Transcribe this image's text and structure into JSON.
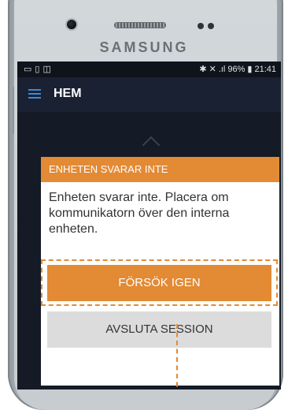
{
  "device": {
    "brand": "SAMSUNG"
  },
  "statusbar": {
    "battery": "96%",
    "time": "21:41",
    "signal": ".ıl",
    "left_icons": [
      "image-icon",
      "sim-icon",
      "cast-icon"
    ],
    "right_icons": [
      "bluetooth-icon",
      "mute-icon",
      "signal-icon",
      "battery-icon"
    ]
  },
  "appbar": {
    "title": "HEM"
  },
  "dialog": {
    "header": "ENHETEN SVARAR INTE",
    "message": "Enheten svarar inte. Placera om kommunikatorn över den interna enheten.",
    "retry_label": "FÖRSÖK IGEN",
    "end_label": "AVSLUTA SESSION"
  },
  "colors": {
    "accent": "#e38a35",
    "appbar": "#1a2132",
    "dialog_bg": "#ffffff",
    "end_button": "#dcdcdc"
  }
}
